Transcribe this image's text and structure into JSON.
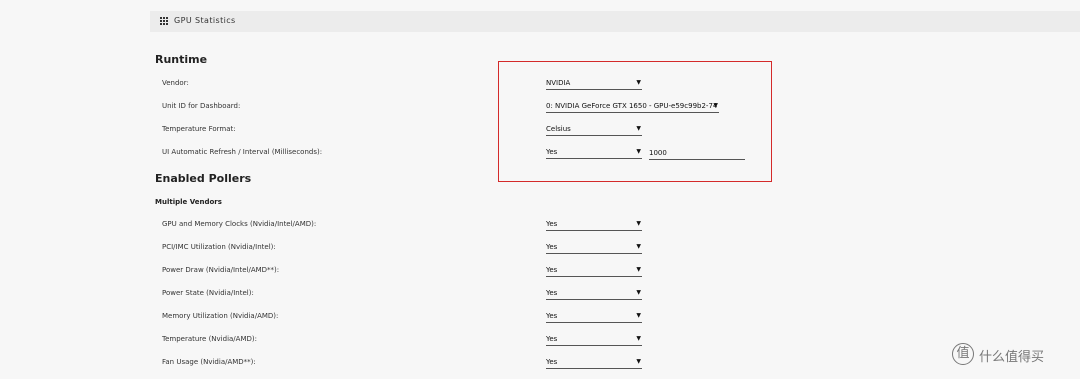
{
  "header": {
    "title": "GPU Statistics",
    "icon": "grid-icon"
  },
  "runtime": {
    "title": "Runtime",
    "vendor": {
      "label": "Vendor:",
      "value": "NVIDIA"
    },
    "unit": {
      "label": "Unit ID for Dashboard:",
      "value": "0: NVIDIA GeForce GTX 1650 - GPU-e59c99b2-74"
    },
    "temp_format": {
      "label": "Temperature Format:",
      "value": "Celsius"
    },
    "refresh": {
      "label": "UI Automatic Refresh / Interval (Milliseconds):",
      "value": "Yes",
      "interval": "1000"
    }
  },
  "pollers": {
    "title": "Enabled Pollers",
    "subtitle": "Multiple Vendors",
    "items": [
      {
        "label": "GPU and Memory Clocks (Nvidia/Intel/AMD):",
        "value": "Yes"
      },
      {
        "label": "PCI/IMC Utilization (Nvidia/Intel):",
        "value": "Yes"
      },
      {
        "label": "Power Draw (Nvidia/Intel/AMD**):",
        "value": "Yes"
      },
      {
        "label": "Power State (Nvidia/Intel):",
        "value": "Yes"
      },
      {
        "label": "Memory Utilization (Nvidia/AMD):",
        "value": "Yes"
      },
      {
        "label": "Temperature (Nvidia/AMD):",
        "value": "Yes"
      },
      {
        "label": "Fan Usage (Nvidia/AMD**):",
        "value": "Yes"
      }
    ]
  },
  "highlight_color": "#d42a2a",
  "watermark": {
    "logo": "值",
    "text": "什么值得买"
  }
}
